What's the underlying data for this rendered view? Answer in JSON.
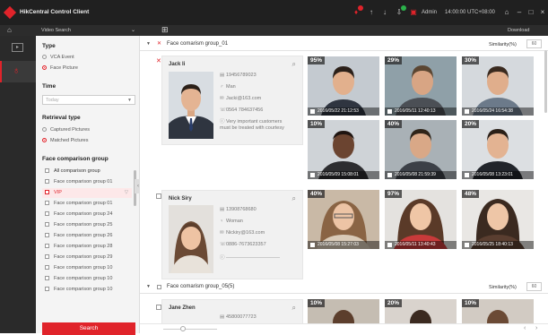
{
  "app": {
    "title": "HikCentral Control Client",
    "user": "Admin",
    "time": "14:00:00 UTC+08:00"
  },
  "tabbar": {
    "tab_label": "Video Search",
    "download_label": "Download"
  },
  "filter": {
    "type_title": "Type",
    "type_options": [
      "VCA Event",
      "Face Picture"
    ],
    "type_selected": 1,
    "time_title": "Time",
    "time_value": "Today",
    "retrieval_title": "Retrieval type",
    "retrieval_options": [
      "Captured Pictures",
      "Matched Pictures"
    ],
    "retrieval_selected": 1,
    "fcg_title": "Face comparison group",
    "fcg_all": "All comparison group",
    "groups": [
      "Face comparison group 01",
      "VIP",
      "Face comparison group 01",
      "Face comparison group 24",
      "Face comparison group 25",
      "Face comparison group 26",
      "Face comparison group 28",
      "Face comparison group 29",
      "Face comparison group 10",
      "Face comparison group 10",
      "Face comparison group 10"
    ],
    "selected_group": 1,
    "search_label": "Search"
  },
  "main": {
    "similarity_label": "Similarity(%)",
    "group1": {
      "title": "Face comarism group_01"
    },
    "group2": {
      "title": "Face comarism group_05(5)"
    },
    "person1": {
      "name": "Jack Ii",
      "id": "19456789023",
      "gender": "Man",
      "email": "Jacki@163.com",
      "phone": "0564 784637456",
      "note": "Very important customers must be treated with courtesy"
    },
    "person2": {
      "name": "Nick Siry",
      "id": "13908768680",
      "gender": "Woman",
      "email": "Nickiry@163.com",
      "phone": "0886-7673623357"
    },
    "person3": {
      "name": "Jane Zhen",
      "id": "45800077723"
    },
    "row1_thumbs": [
      {
        "pct": "95%",
        "cap": "2016/05/22  21:12:53"
      },
      {
        "pct": "29%",
        "cap": "2016/05/11  12:40:13"
      },
      {
        "pct": "30%",
        "cap": "2016/05/24  16:54:38"
      }
    ],
    "row1b_thumbs": [
      {
        "pct": "10%",
        "cap": "2016/05/09  15:08:01"
      },
      {
        "pct": "40%",
        "cap": "2016/05/08  21:59:39"
      },
      {
        "pct": "20%",
        "cap": "2016/05/08  13:23:01"
      }
    ],
    "row2_thumbs": [
      {
        "pct": "40%",
        "cap": "2016/05/08  15:27:03"
      },
      {
        "pct": "97%",
        "cap": "2016/05/11  13:40:43"
      },
      {
        "pct": "48%",
        "cap": "2016/05/25  18:40:13"
      }
    ],
    "row3_thumbs": [
      {
        "pct": "10%"
      },
      {
        "pct": "20%"
      },
      {
        "pct": "10%"
      }
    ]
  }
}
